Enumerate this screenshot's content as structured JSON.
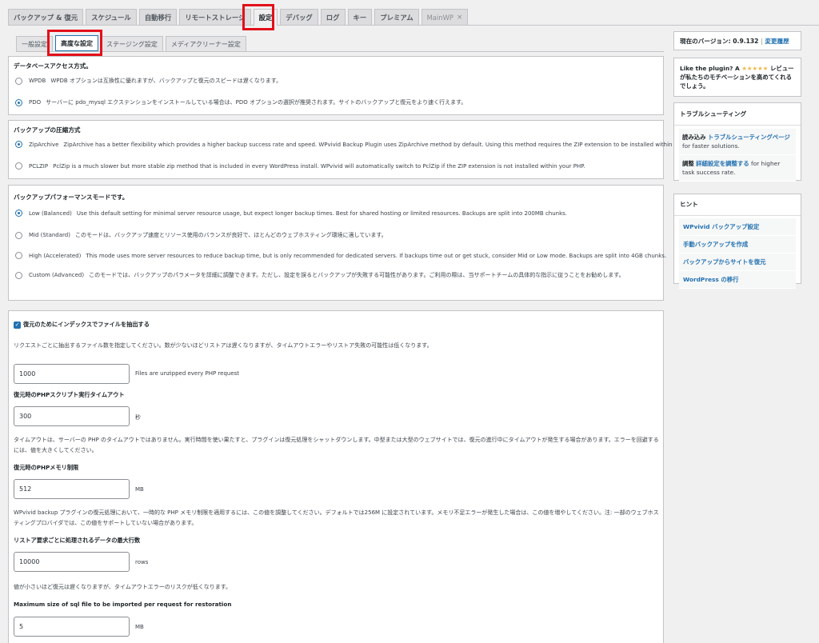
{
  "top_tabs": [
    {
      "label": "バックアップ & 復元"
    },
    {
      "label": "スケジュール"
    },
    {
      "label": "自動移行"
    },
    {
      "label": "リモートストレージ"
    },
    {
      "label": "設定"
    },
    {
      "label": "デバッグ"
    },
    {
      "label": "ログ"
    },
    {
      "label": "キー"
    },
    {
      "label": "プレミアム"
    },
    {
      "label": "MainWP",
      "close": "×"
    }
  ],
  "sub_tabs": [
    {
      "label": "一般設定"
    },
    {
      "label": "高度な設定"
    },
    {
      "label": "ステージング設定"
    },
    {
      "label": "メディアクリーナー設定"
    }
  ],
  "db_access": {
    "title": "データベースアクセス方式。",
    "options": [
      {
        "label": "WPDB",
        "desc": "WPDB オプションは互換性に優れますが、バックアップと復元のスピードは遅くなります。",
        "selected": false
      },
      {
        "label": "PDO",
        "desc": "サーバーに pdo_mysql エクステンションをインストールしている場合は、PDO オプションの選択が推奨されます。サイトのバックアップと復元をより速く行えます。",
        "selected": true
      }
    ]
  },
  "compression": {
    "title": "バックアップの圧縮方式",
    "options": [
      {
        "label": "ZipArchive",
        "desc": "ZipArchive has a better flexibility which provides a higher backup success rate and speed. WPvivid Backup Plugin uses ZipArchive method by default. Using this method requires the ZIP extension to be installed within your PHP.",
        "selected": true
      },
      {
        "label": "PCLZIP",
        "desc": "PclZip is a much slower but more stable zip method that is included in every WordPress install. WPvivid will automatically switch to PclZip if the ZIP extension is not installed within your PHP.",
        "selected": false
      }
    ]
  },
  "performance": {
    "title": "バックアップパフォーマンスモードです。",
    "options": [
      {
        "label": "Low (Balanced)",
        "desc": "Use this default setting for minimal server resource usage, but expect longer backup times. Best for shared hosting or limited resources. Backups are split into 200MB chunks.",
        "selected": true
      },
      {
        "label": "Mid (Standard)",
        "desc": "このモードは、バックアップ速度とリソース使用のバランスが良好で、ほとんどのウェブホスティング環境に適しています。",
        "selected": false
      },
      {
        "label": "High (Accelerated)",
        "desc": "This mode uses more server resources to reduce backup time, but is only recommended for dedicated servers. If backups time out or get stuck, consider Mid or Low mode. Backups are split into 4GB chunks.",
        "selected": false
      },
      {
        "label": "Custom (Advanced)",
        "desc": "このモードでは、バックアップのパラメータを詳細に調整できます。ただし、設定を誤るとバックアップが失敗する可能性があります。ご利用の際は、当サポートチームの具体的な指示に従うことをお勧めします。",
        "selected": false
      }
    ]
  },
  "restore": {
    "checkbox_label": "復元のためにインデックスでファイルを抽出する",
    "checkbox_desc": "リクエストごとに抽出するファイル数を指定してください。数が少ないほどリストアは遅くなりますが、タイムアウトエラーやリストア失敗の可能性は低くなります。",
    "files_value": "1000",
    "files_unit": "Files are unzipped every PHP request",
    "timeout_label": "復元時のPHPスクリプト実行タイムアウト",
    "timeout_value": "300",
    "timeout_unit": "秒",
    "timeout_desc": "タイムアウトは、サーバーの PHP のタイムアウトではありません。実行時間を使い果たすと、プラグインは復元処理をシャットダウンします。中型または大型のウェブサイトでは、復元の進行中にタイムアウトが発生する場合があります。エラーを回避するには、値を大きくしてください。",
    "memory_label": "復元時のPHPメモリ制限",
    "memory_value": "512",
    "memory_unit": "MB",
    "memory_desc": "WPvivid backup プラグインの復元処理において、一時的な PHP メモリ制限を適用するには、この値を調整してください。デフォルトでは256M に設定されています。メモリ不足エラーが発生した場合は、この値を増やしてください。注: 一部のウェブホスティングプロバイダでは、この値をサポートしていない場合があります。",
    "rows_label": "リストア要求ごとに処理されるデータの最大行数",
    "rows_value": "10000",
    "rows_unit": "rows",
    "rows_desc": "値が小さいほど復元は遅くなりますが、タイムアウトエラーのリスクが低くなります。",
    "sql_label": "Maximum size of sql file to be imported per request for restoration",
    "sql_value": "5",
    "sql_unit": "MB"
  },
  "sidebar": {
    "version_label": "現在のバージョン: 0.9.132",
    "version_sep": "|",
    "changelog_link": "変更履歴",
    "like_prefix": "Like the plugin? A",
    "like_stars": "★★★★★",
    "like_suffix": "レビューが私たちのモチベーションを高めてくれるでしょう。",
    "troubleshooting_title": "トラブルシューティング",
    "ts1_prefix": "読み込み",
    "ts1_link": "トラブルシューティングページ",
    "ts1_suffix": "for faster solutions.",
    "ts2_prefix": "調整",
    "ts2_link": "詳細設定を調整する",
    "ts2_suffix": "for higher task success rate.",
    "hints_title": "ヒント",
    "hints": [
      {
        "label": "WPvivid バックアップ設定"
      },
      {
        "label": "手動バックアップを作成"
      },
      {
        "label": "バックアップからサイトを復元"
      },
      {
        "label": "WordPress の移行"
      }
    ]
  },
  "colors": {
    "accent": "#2271b1",
    "highlight": "#e3101a",
    "stars": "#f0b849"
  }
}
